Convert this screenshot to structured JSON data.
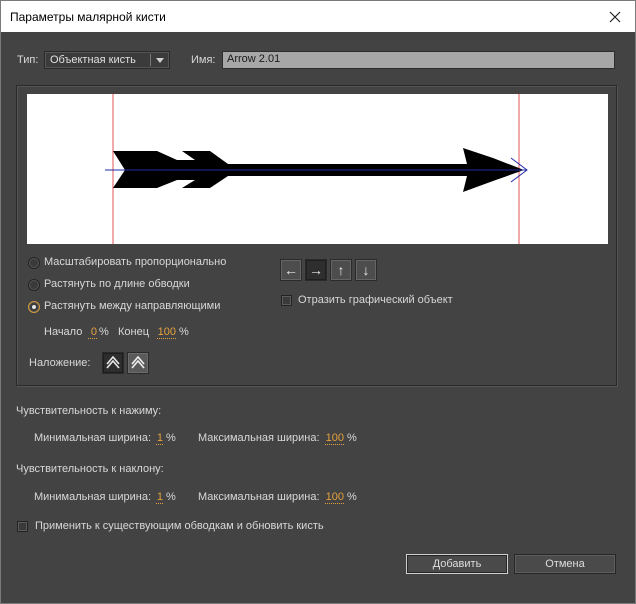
{
  "window": {
    "title": "Параметры малярной кисти"
  },
  "type_field": {
    "label": "Тип:",
    "value": "Объектная кисть"
  },
  "name_field": {
    "label": "Имя:",
    "value": "Arrow 2.01"
  },
  "scale_options": [
    {
      "label": "Масштабировать пропорционально",
      "checked": false
    },
    {
      "label": "Растянуть по длине обводки",
      "checked": false
    },
    {
      "label": "Растянуть между направляющими",
      "checked": true
    }
  ],
  "guides": {
    "start_label": "Начало",
    "start_value": "0",
    "end_label": "Конец",
    "end_value": "100",
    "unit": "%"
  },
  "direction_buttons": [
    {
      "icon": "arrow-left-icon",
      "glyph": "←",
      "active": false
    },
    {
      "icon": "arrow-right-icon",
      "glyph": "→",
      "active": true
    },
    {
      "icon": "arrow-up-icon",
      "glyph": "↑",
      "active": false
    },
    {
      "icon": "arrow-down-icon",
      "glyph": "↓",
      "active": false
    }
  ],
  "flip": {
    "label": "Отразить графический объект",
    "checked": false
  },
  "overlap": {
    "label": "Наложение:"
  },
  "pressure": {
    "heading": "Чувствительность к нажиму:",
    "min_label": "Минимальная ширина:",
    "min_value": "1",
    "max_label": "Максимальная ширина:",
    "max_value": "100",
    "unit": "%"
  },
  "tilt": {
    "heading": "Чувствительность к наклону:",
    "min_label": "Минимальная ширина:",
    "min_value": "1",
    "max_label": "Максимальная ширина:",
    "max_value": "100",
    "unit": "%"
  },
  "apply": {
    "label": "Применить к существующим обводкам и обновить кисть",
    "checked": false
  },
  "buttons": {
    "add": "Добавить",
    "cancel": "Отмена"
  },
  "colors": {
    "accent": "#e4a13d",
    "guide_line": "#e0545a",
    "stroke_line": "#1f2aa8",
    "dialog_bg": "#434343"
  }
}
